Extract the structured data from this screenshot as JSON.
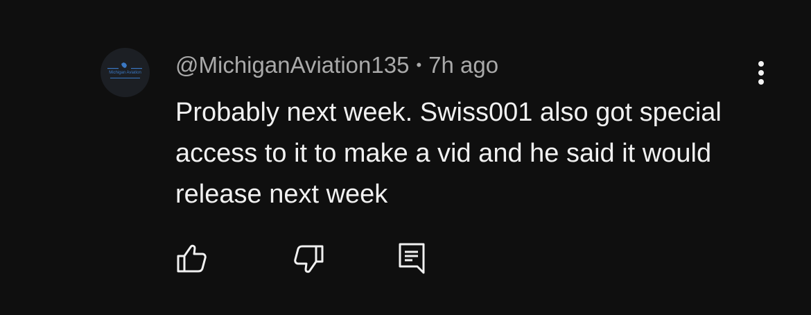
{
  "comment": {
    "author": "@MichiganAviation135",
    "separator": "•",
    "time": "7h ago",
    "text": "Probably next week. Swiss001 also got special access to it to make a vid and he said it would release next week",
    "avatar_text": "Michigan Aviation"
  },
  "icons": {
    "menu": "more-vertical-icon",
    "like": "thumbs-up-icon",
    "dislike": "thumbs-down-icon",
    "reply": "reply-icon"
  },
  "colors": {
    "background": "#0f0f0f",
    "primary_text": "#f1f1f1",
    "secondary_text": "#aaaaaa",
    "avatar_accent": "#3a78c4"
  }
}
